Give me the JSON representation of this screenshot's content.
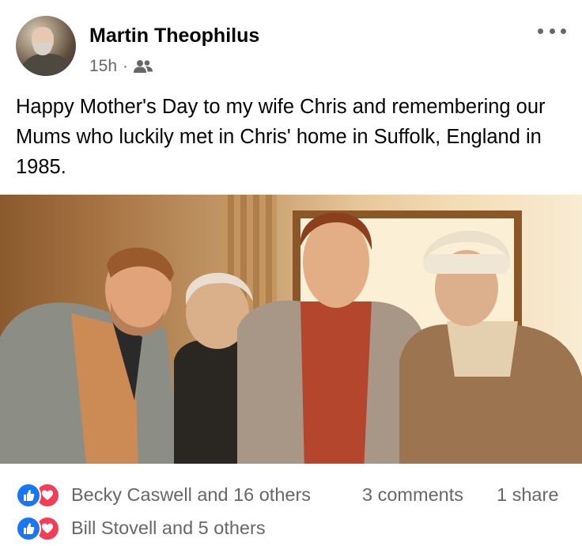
{
  "post": {
    "author": "Martin Theophilus",
    "time": "15h",
    "separator": "·",
    "audience_icon": "friends-icon",
    "menu_icon": "more-options-icon",
    "text": "Happy Mother's Day to my wife Chris and remembering our Mums who luckily met in Chris' home in Suffolk, England in 1985."
  },
  "photo": {
    "description_icon": "family-photo"
  },
  "engagement": {
    "reactions": "Becky Caswell and 16 others",
    "comments": "3 comments",
    "shares": "1 share"
  },
  "comment_reactions": {
    "reactions": "Bill Stovell and 5 others"
  },
  "colors": {
    "like": "#1877f2",
    "love": "#f33e58",
    "secondary_text": "#65676b"
  }
}
